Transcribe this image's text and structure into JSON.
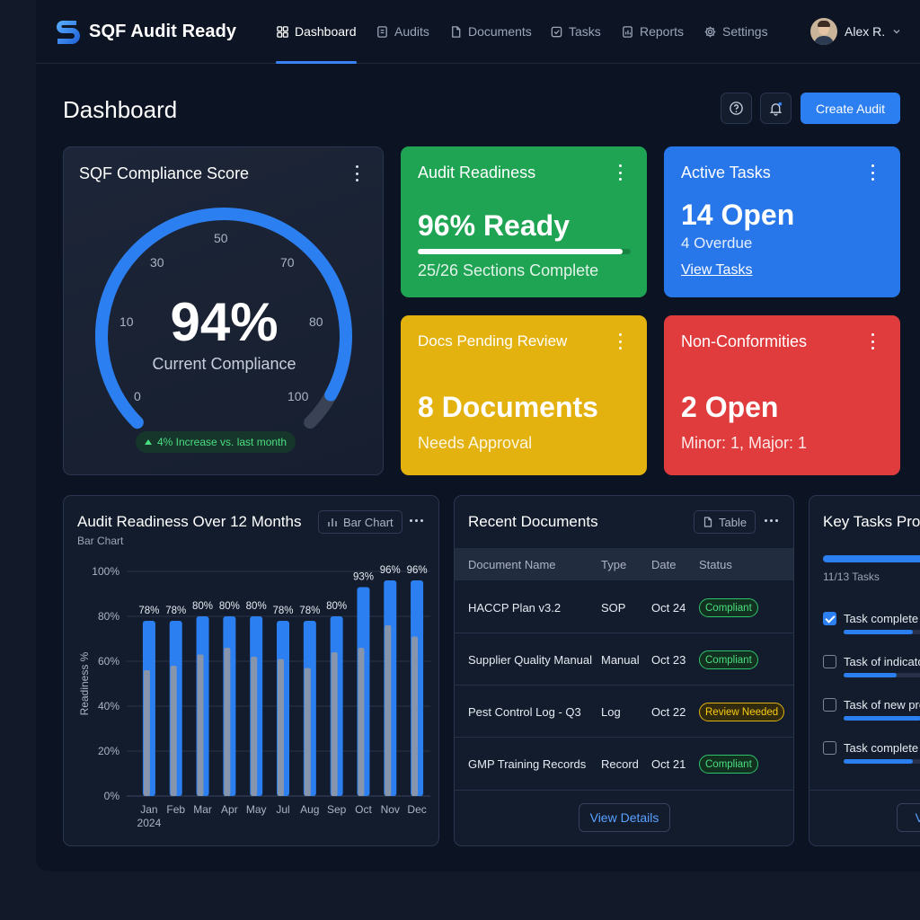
{
  "brand": {
    "name": "SQF Audit Ready"
  },
  "nav": {
    "items": [
      {
        "label": "Dashboard",
        "icon": "grid-icon",
        "active": true
      },
      {
        "label": "Audits",
        "icon": "list-icon"
      },
      {
        "label": "Documents",
        "icon": "file-icon"
      },
      {
        "label": "Tasks",
        "icon": "check-square-icon"
      },
      {
        "label": "Reports",
        "icon": "report-icon"
      },
      {
        "label": "Settings",
        "icon": "gear-icon"
      }
    ]
  },
  "user": {
    "name": "Alex R."
  },
  "page": {
    "title": "Dashboard",
    "create_label": "Create Audit"
  },
  "gauge": {
    "title": "SQF Compliance Score",
    "value": 94,
    "value_text": "94%",
    "label": "Current Compliance",
    "ticks": [
      "0",
      "10",
      "30",
      "50",
      "70",
      "80",
      "100"
    ],
    "trend": "4% Increase vs. last month"
  },
  "readiness": {
    "title": "Audit Readiness",
    "value": "96% Ready",
    "progress": 0.96,
    "detail": "25/26 Sections Complete"
  },
  "active_tasks": {
    "title": "Active Tasks",
    "value": "14 Open",
    "detail": "4 Overdue",
    "link": "View Tasks"
  },
  "docs_pending": {
    "title": "Docs Pending Review",
    "value": "8 Documents",
    "detail": "Needs Approval"
  },
  "nonconf": {
    "title": "Non-Conformities",
    "value": "2 Open",
    "detail": "Minor: 1, Major: 1"
  },
  "chart_panel": {
    "title": "Audit Readiness Over 12 Months",
    "subtitle": "Bar Chart",
    "toggle_label": "Bar Chart"
  },
  "chart_data": {
    "type": "bar",
    "categories": [
      "Jan",
      "Feb",
      "Mar",
      "Apr",
      "May",
      "Jul",
      "Aug",
      "Sep",
      "Oct",
      "Nov",
      "Dec"
    ],
    "year_label": "2024",
    "series": [
      {
        "values": [
          78,
          78,
          80,
          80,
          80,
          78,
          78,
          80,
          93,
          96,
          96
        ],
        "color": "#2b7ff0"
      },
      {
        "values": [
          56,
          58,
          63,
          66,
          62,
          61,
          57,
          64,
          66,
          76,
          71
        ],
        "color": "#8e97a6"
      }
    ],
    "data_labels": [
      "78%",
      "78%",
      "80%",
      "80%",
      "80%",
      "78%",
      "78%",
      "80%",
      "93%",
      "96%",
      "96%"
    ],
    "ylabel": "Readiness %",
    "ylim": [
      0,
      100
    ],
    "yticks": [
      "0%",
      "20%",
      "40%",
      "60%",
      "80%",
      "100%"
    ],
    "grid": true
  },
  "docs_panel": {
    "title": "Recent Documents",
    "toggle_label": "Table",
    "columns": [
      "Document Name",
      "Type",
      "Date",
      "Status"
    ],
    "rows": [
      {
        "name": "HACCP Plan v3.2",
        "type": "SOP",
        "date": "Oct 24",
        "status": "Compliant",
        "status_kind": "ok"
      },
      {
        "name": "Supplier Quality Manual",
        "type": "Manual",
        "date": "Oct 23",
        "status": "Compliant",
        "status_kind": "ok"
      },
      {
        "name": "Pest Control Log - Q3",
        "type": "Log",
        "date": "Oct 22",
        "status": "Review Needed",
        "status_kind": "warn"
      },
      {
        "name": "GMP Training Records",
        "type": "Record",
        "date": "Oct 21",
        "status": "Compliant",
        "status_kind": "ok"
      }
    ],
    "button": "View Details"
  },
  "tasks_panel": {
    "title": "Key Tasks Progress",
    "count": "11/13 Tasks",
    "progress": 0.85,
    "items": [
      {
        "label": "Task complete",
        "checked": true,
        "progress": 0.85
      },
      {
        "label": "Task of indicator",
        "checked": false,
        "progress": 0.65
      },
      {
        "label": "Task of new process",
        "checked": false,
        "progress": 0.95
      },
      {
        "label": "Task complete",
        "checked": false,
        "progress": 0.85
      }
    ],
    "button": "View All"
  }
}
